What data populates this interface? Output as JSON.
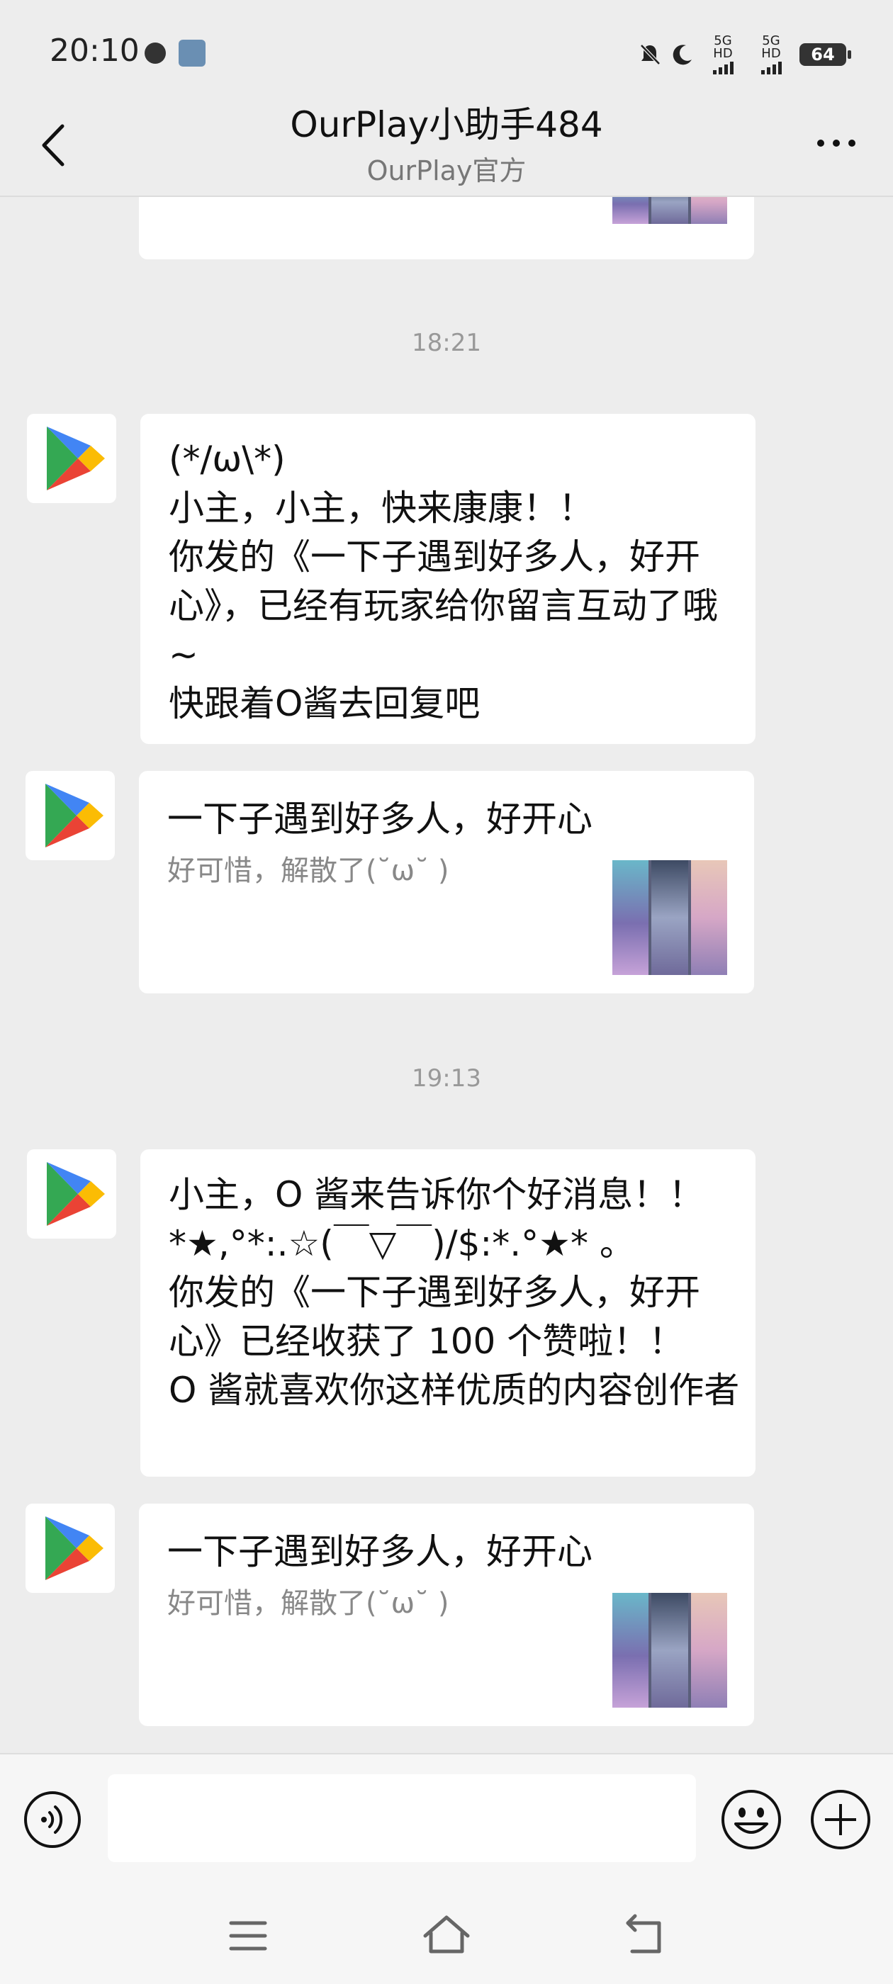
{
  "status_bar": {
    "time": "20:10",
    "network1": "5G HD",
    "network2": "5G HD",
    "battery": "64"
  },
  "header": {
    "title": "OurPlay小助手484",
    "subtitle": "OurPlay官方"
  },
  "messages": {
    "t1": "18:21",
    "m1": "(*/ω\\*)\n小主，小主，快来康康！！\n你发的《一下子遇到好多人，好开心》，已经有玩家给你留言互动了哦~\n快跟着O酱去回复吧",
    "c1_title": "一下子遇到好多人，好开心",
    "c1_desc": "好可惜，解散了(˘ω˘ )",
    "t2": "19:13",
    "m2": "小主，O 酱来告诉你个好消息！！\n*★,°*:.☆(￣▽￣)/$:*.°★* 。\n你发的《一下子遇到好多人，好开心》已经收获了 100 个赞啦！！\nO 酱就喜欢你这样优质的内容创作者",
    "c2_title": "一下子遇到好多人，好开心",
    "c2_desc": "好可惜，解散了(˘ω˘ )"
  },
  "input": {
    "placeholder": "",
    "value": ""
  },
  "icons": {
    "back": "chevron-left-icon",
    "more": "more-dots-icon",
    "voice": "voice-icon",
    "emoji": "emoji-icon",
    "plus": "plus-icon",
    "menu": "menu-icon",
    "home": "home-icon",
    "return": "back-arrow-icon",
    "avatar": "google-play-icon"
  },
  "colors": {
    "background": "#ededed",
    "bubble": "#ffffff",
    "play_green": "#34a853",
    "play_blue": "#4285f4",
    "play_yellow": "#fbbc04",
    "play_red": "#ea4335"
  }
}
